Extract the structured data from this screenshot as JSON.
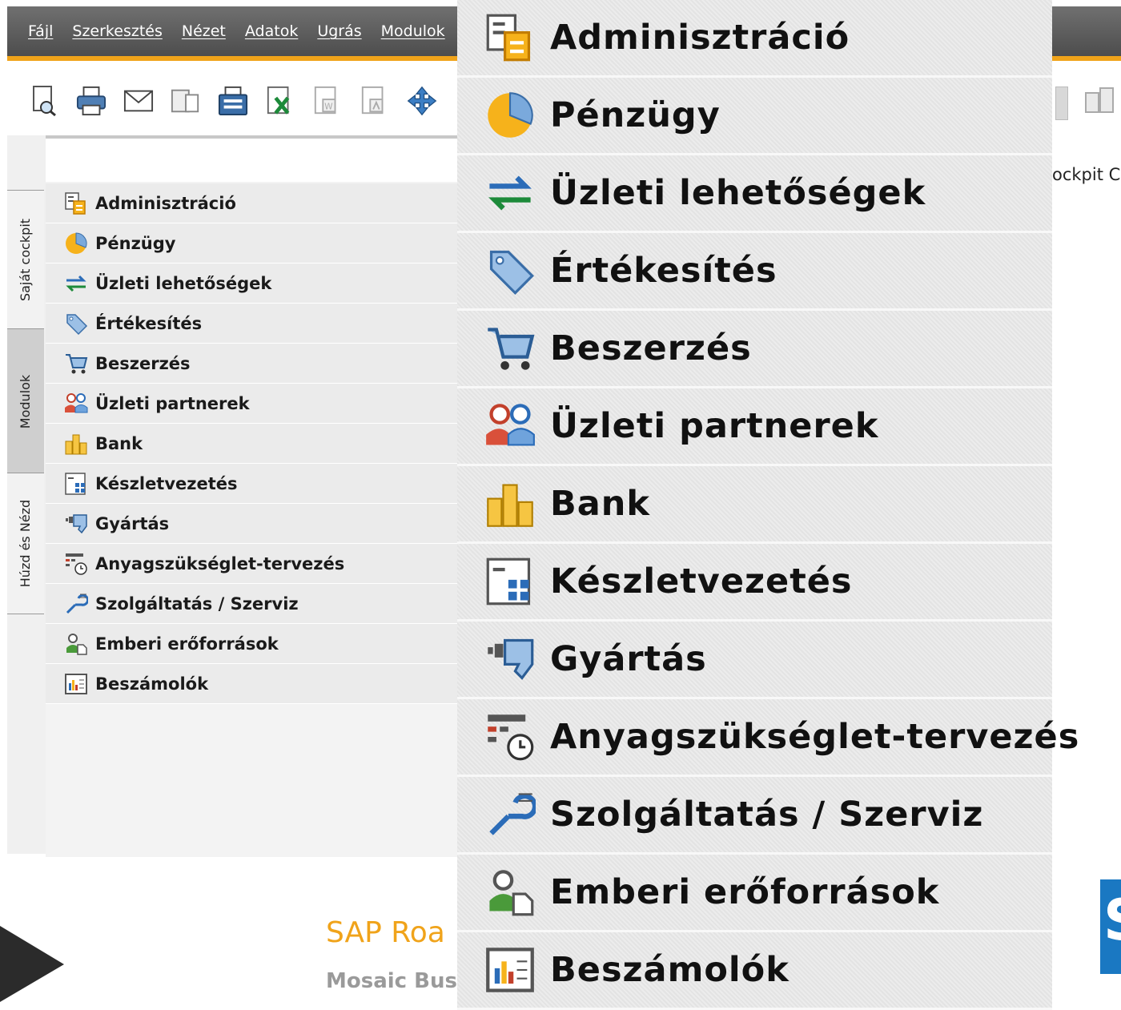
{
  "menubar": {
    "items": [
      "Fájl",
      "Szerkesztés",
      "Nézet",
      "Adatok",
      "Ugrás",
      "Modulok"
    ]
  },
  "sidetabs": [
    "Saját cockpit",
    "Modulok",
    "Húzd és Nézd"
  ],
  "modules": [
    {
      "label": "Adminisztráció",
      "icon": "administration-icon"
    },
    {
      "label": "Pénzügy",
      "icon": "finance-pie-icon"
    },
    {
      "label": "Üzleti lehetőségek",
      "icon": "opportunities-arrows-icon"
    },
    {
      "label": "Értékesítés",
      "icon": "sales-tags-icon"
    },
    {
      "label": "Beszerzés",
      "icon": "purchasing-cart-icon"
    },
    {
      "label": "Üzleti partnerek",
      "icon": "business-partners-icon"
    },
    {
      "label": "Bank",
      "icon": "bank-coins-icon"
    },
    {
      "label": "Készletvezetés",
      "icon": "inventory-icon"
    },
    {
      "label": "Gyártás",
      "icon": "production-icon"
    },
    {
      "label": "Anyagszükséglet-tervezés",
      "icon": "mrp-clock-icon"
    },
    {
      "label": "Szolgáltatás / Szerviz",
      "icon": "service-wrench-icon"
    },
    {
      "label": "Emberi erőforrások",
      "icon": "human-resources-icon"
    },
    {
      "label": "Beszámolók",
      "icon": "reports-chart-icon"
    }
  ],
  "cockpit_text": "ockpit Co",
  "footer": {
    "title": "SAP Roa",
    "subtitle": "Mosaic Bus"
  },
  "sap_logo_letter": "S"
}
